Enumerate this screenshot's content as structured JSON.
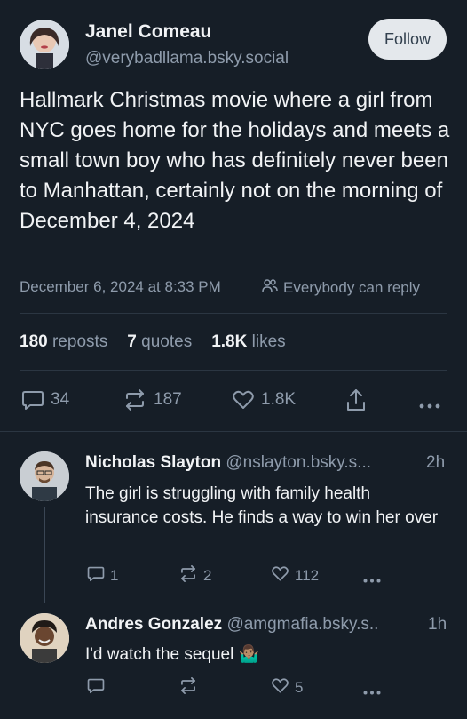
{
  "post": {
    "author_name": "Janel Comeau",
    "author_handle": "@verybadllama.bsky.social",
    "follow_label": "Follow",
    "text": "Hallmark Christmas movie where a girl from NYC goes home for the holidays and meets a small town boy who has definitely never been to Manhattan, certainly not on the morning of December 4, 2024",
    "timestamp": "December 6, 2024 at 8:33 PM",
    "reply_setting": "Everybody can reply",
    "stats": {
      "reposts_count": "180",
      "reposts_label": "reposts",
      "quotes_count": "7",
      "quotes_label": "quotes",
      "likes_count": "1.8K",
      "likes_label": "likes"
    },
    "actions": {
      "replies": "34",
      "reposts": "187",
      "likes": "1.8K"
    }
  },
  "replies": [
    {
      "author_name": "Nicholas Slayton",
      "author_handle": "@nslayton.bsky.s...",
      "age": "2h",
      "text": "The girl is struggling with family health insurance costs. He finds a way to win her over",
      "replies": "1",
      "reposts": "2",
      "likes": "112"
    },
    {
      "author_name": "Andres Gonzalez",
      "author_handle": "@amgmafia.bsky.s..",
      "age": "1h",
      "text": "I'd watch the sequel",
      "emoji": "🤷🏽‍♂️",
      "replies": "",
      "reposts": "",
      "likes": "5"
    }
  ],
  "colors": {
    "background": "#161e27",
    "muted_text": "#8e9bab",
    "divider": "#2b3642",
    "follow_button": "#e4e8ec"
  }
}
